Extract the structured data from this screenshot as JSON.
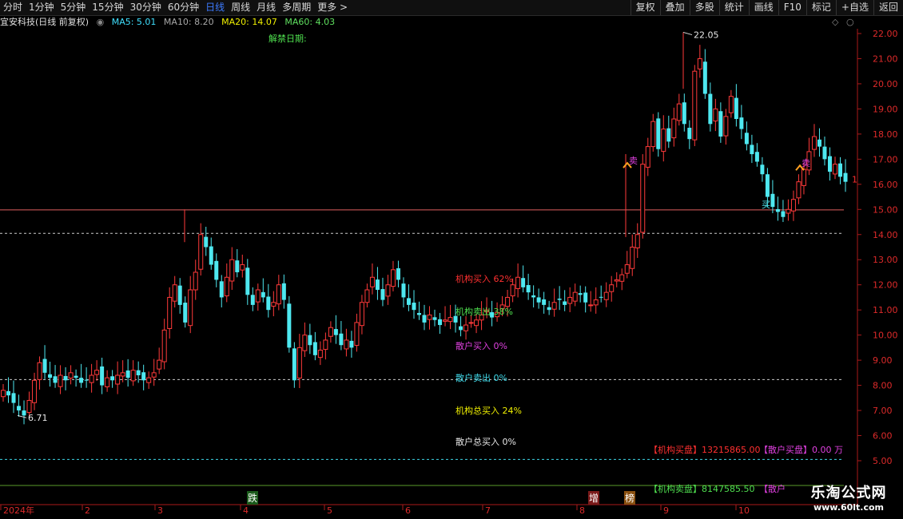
{
  "toolbar": {
    "periods": [
      "分时",
      "1分钟",
      "5分钟",
      "15分钟",
      "30分钟",
      "60分钟",
      "日线",
      "周线",
      "月线",
      "多周期",
      "更多 >"
    ],
    "active_index": 6,
    "right_buttons": [
      "复权",
      "叠加",
      "多股",
      "统计",
      "画线",
      "F10",
      "标记",
      "+自选",
      "返回"
    ]
  },
  "info": {
    "stock": "宜安科技(日线 前复权)",
    "ma5": "MA5: 5.01",
    "ma10": "MA10: 8.20",
    "ma20": "MA20: 14.07",
    "ma60": "MA60: 4.03",
    "unlock": "解禁日期:"
  },
  "indicators": {
    "inst_buy": "机构买入 62%",
    "inst_sell": "机构卖出 38%",
    "retail_buy": "散户买入 0%",
    "retail_sell": "散户卖出 0%",
    "inst_total_buy": "机构总买入 24%",
    "retail_total_buy": "散户总买入 0%",
    "inst_buy_disk": "【机构买盘】13215865.00",
    "retail_buy_disk": "【散户买盘】0.00 万",
    "inst_sell_disk": "【机构卖盘】8147585.50",
    "retail_sell_disk": "【散户"
  },
  "markers": {
    "high": "22.05",
    "low": "6.71",
    "right_cut": "1",
    "die": "跌",
    "zeng": "增",
    "bang": "榜",
    "sell1": "卖",
    "sell2": "卖",
    "buy1": "买"
  },
  "colors": {
    "up": "#ff3a3a",
    "down": "#4ee8f0",
    "axis": "#cc2020",
    "ma20": "#f0f000",
    "ma5": "#ffffff",
    "ma10": "#ffff00"
  },
  "chart_data": {
    "type": "candlestick",
    "y_ticks": [
      "22.00",
      "21.00",
      "20.00",
      "19.00",
      "18.00",
      "17.00",
      "16.00",
      "15.00",
      "14.00",
      "13.00",
      "12.00",
      "11.00",
      "10.00",
      "9.00",
      "8.00",
      "7.00",
      "6.00",
      "5.00"
    ],
    "ylim": [
      4.5,
      22.5
    ],
    "x_labels": [
      "2024年",
      "2",
      "3",
      "4",
      "5",
      "6",
      "7",
      "8",
      "9",
      "10"
    ],
    "reference_lines": [
      {
        "value": 14.98,
        "style": "solid"
      },
      {
        "value": 14.05,
        "style": "dashed"
      },
      {
        "value": 8.23,
        "style": "dashed"
      },
      {
        "value": 5.05,
        "style": "dashed-cyan"
      }
    ],
    "closes": [
      7.8,
      7.6,
      7.3,
      7.0,
      6.8,
      7.4,
      8.2,
      8.9,
      8.5,
      8.3,
      8.1,
      8.4,
      8.2,
      8.5,
      8.3,
      8.1,
      8.2,
      8.4,
      8.6,
      8.0,
      8.3,
      8.2,
      8.4,
      8.5,
      8.3,
      8.6,
      8.4,
      8.2,
      8.3,
      8.5,
      9.0,
      10.2,
      11.5,
      12.0,
      11.2,
      10.5,
      11.8,
      12.5,
      14.0,
      13.5,
      12.8,
      12.2,
      11.5,
      12.3,
      13.0,
      12.5,
      12.8,
      11.6,
      11.2,
      11.8,
      11.5,
      11.0,
      11.3,
      12.0,
      11.4,
      9.5,
      8.2,
      9.5,
      10.0,
      9.6,
      9.2,
      9.4,
      9.8,
      10.3,
      10.0,
      9.6,
      9.8,
      9.5,
      10.5,
      11.3,
      11.8,
      12.3,
      11.8,
      11.4,
      12.0,
      12.6,
      12.2,
      11.5,
      11.2,
      11.0,
      10.8,
      10.5,
      10.8,
      10.6,
      10.4,
      10.6,
      10.7,
      10.5,
      10.2,
      10.4,
      10.5,
      10.6,
      10.8,
      11.0,
      10.7,
      10.9,
      11.2,
      11.5,
      12.0,
      12.3,
      11.9,
      11.7,
      11.5,
      11.3,
      11.2,
      11.0,
      11.3,
      11.4,
      11.2,
      11.5,
      11.7,
      11.6,
      11.3,
      11.2,
      11.4,
      11.5,
      11.7,
      12.0,
      12.2,
      12.4,
      12.8,
      13.5,
      14.0,
      16.8,
      17.5,
      18.5,
      17.4,
      18.2,
      17.7,
      18.6,
      19.2,
      18.4,
      17.8,
      20.5,
      21.0,
      19.6,
      18.4,
      19.0,
      17.9,
      18.7,
      19.5,
      18.6,
      18.2,
      17.6,
      17.2,
      16.9,
      16.4,
      15.5,
      15.1,
      14.9,
      14.7,
      15.0,
      15.4,
      16.1,
      16.6,
      17.3,
      17.9,
      17.5,
      17.0,
      16.5,
      16.8,
      16.3,
      16.1
    ]
  }
}
